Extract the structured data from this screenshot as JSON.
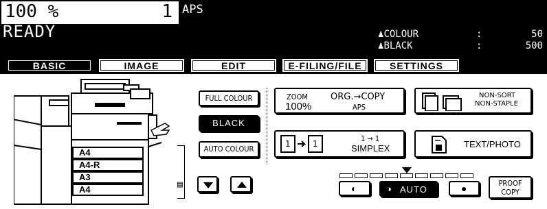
{
  "status": {
    "zoom": "100 %",
    "copies": "1",
    "paper_mode": "APS",
    "state": "READY",
    "counters": [
      {
        "label": "COLOUR",
        "value": "50"
      },
      {
        "label": "BLACK",
        "value": "500"
      }
    ]
  },
  "tabs": [
    "BASIC",
    "IMAGE",
    "EDIT",
    "E-FILING/FILE",
    "SETTINGS"
  ],
  "color_mode": {
    "full_colour": "FULL COLOUR",
    "black": "BLACK",
    "auto_colour": "AUTO COLOUR"
  },
  "zoom_button": {
    "title": "ZOOM",
    "value": "100%",
    "org_copy": "ORG.→COPY",
    "paper": "APS"
  },
  "finishing_button": {
    "line1": "NON-SORT",
    "line2": "NON-STAPLE"
  },
  "duplex_button": {
    "mode": "1 → 1",
    "label": "SIMPLEX"
  },
  "original_mode_button": {
    "label": "TEXT/PHOTO"
  },
  "paper_trays": [
    "A4",
    "A4-R",
    "A3",
    "A4"
  ],
  "density": {
    "auto_label": "AUTO",
    "level_fraction": 0.5
  },
  "proof_copy": {
    "line1": "PROOF",
    "line2": "COPY"
  }
}
